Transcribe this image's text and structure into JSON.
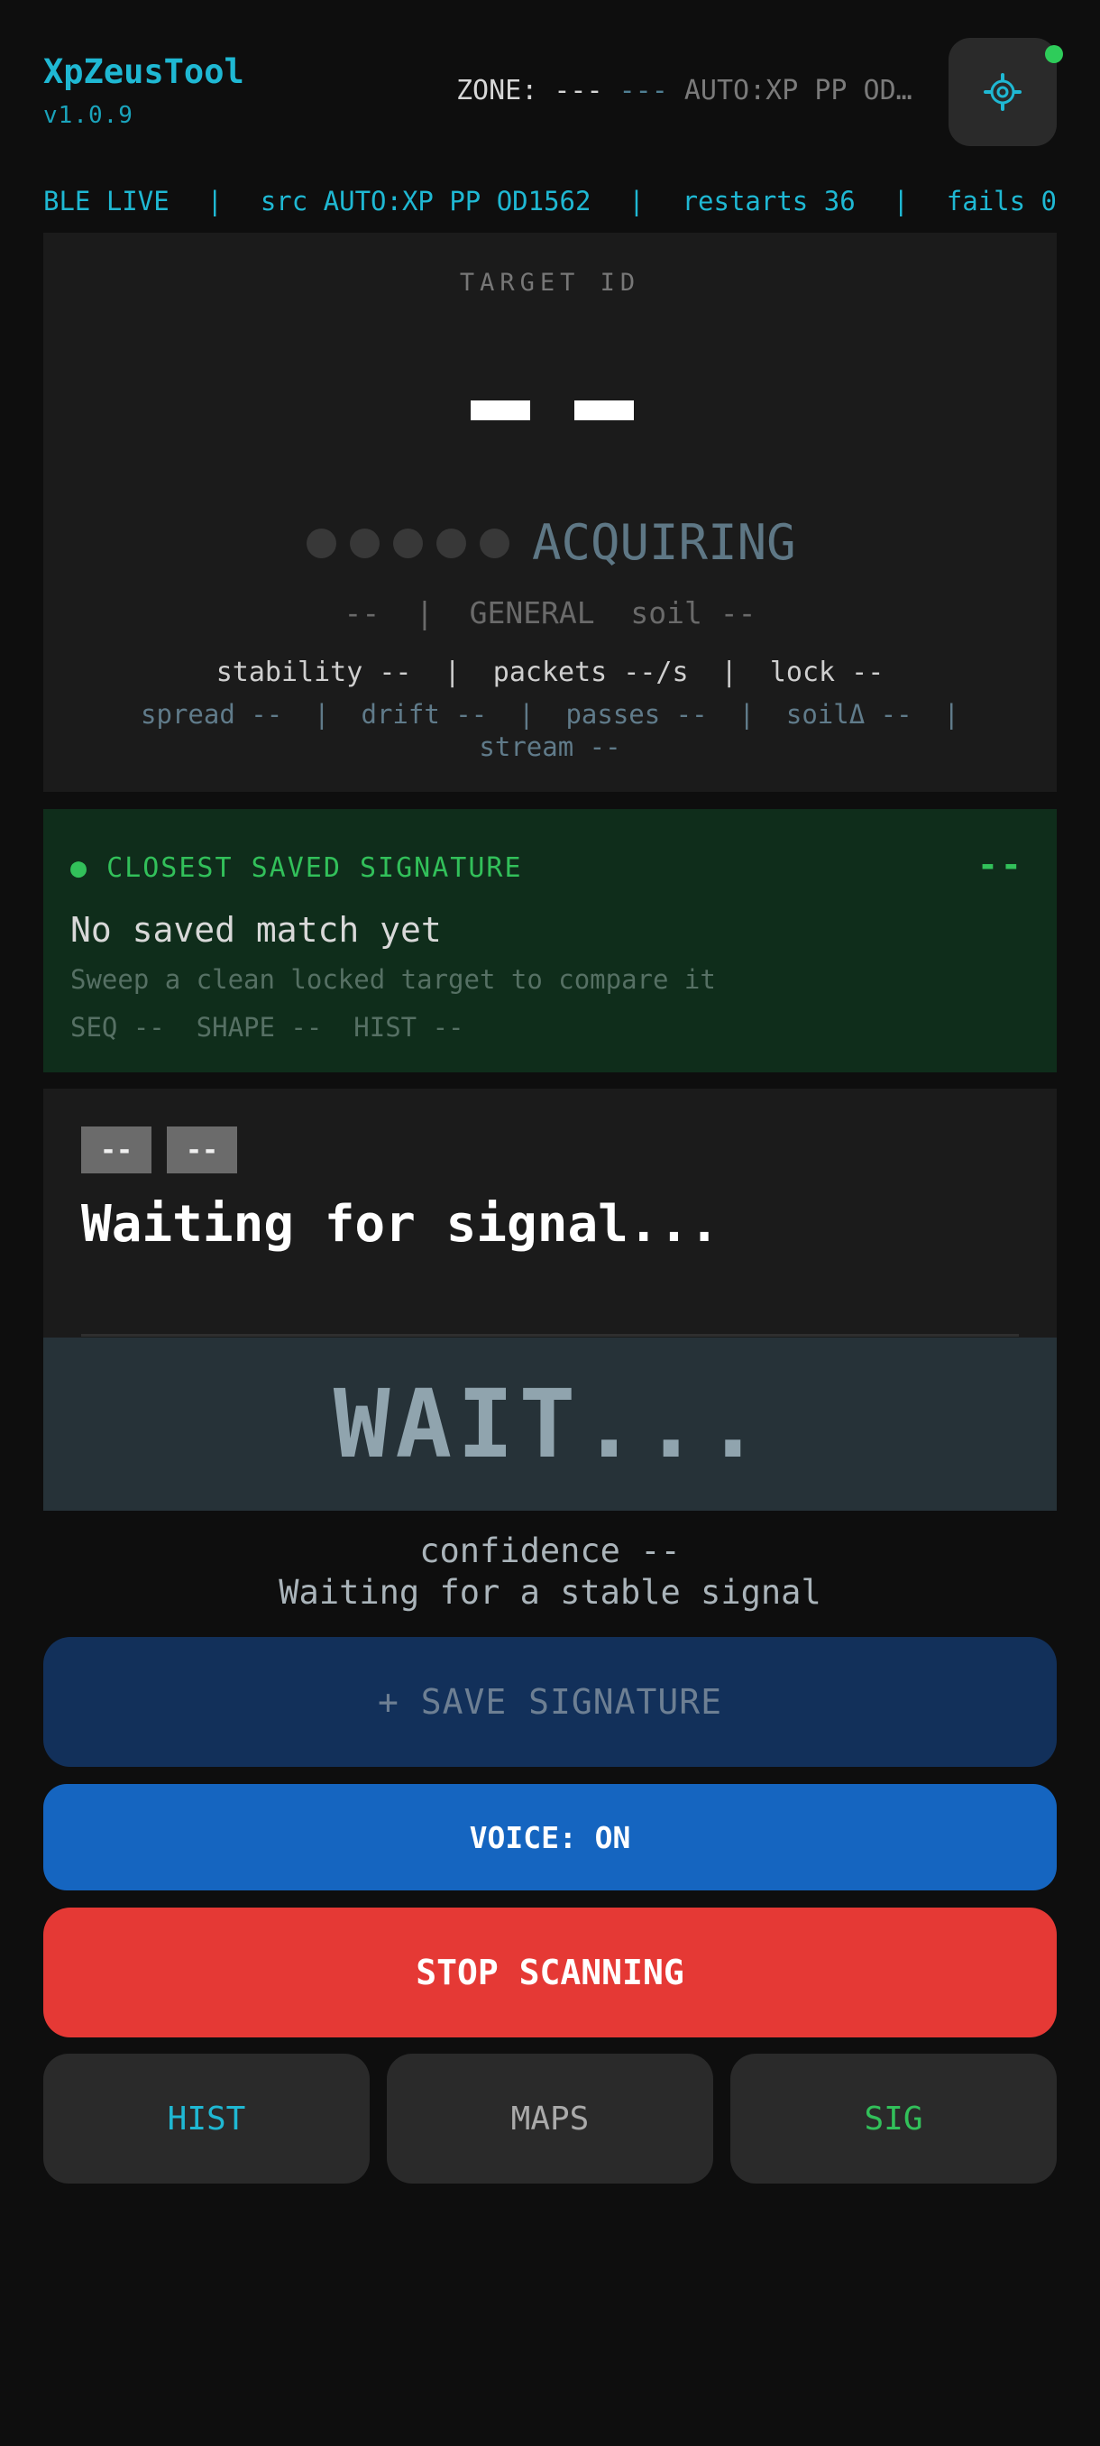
{
  "header": {
    "app_title": "XpZeusTool",
    "version": "v1.0.9",
    "zone_label": "ZONE:",
    "zone_value": "---",
    "zone_dashes": "---",
    "zone_source": "AUTO:XP PP OD…",
    "settings_icon": "gear-icon",
    "status_color": "#2ecc5a"
  },
  "ble_strip": {
    "ble": "BLE LIVE",
    "sep": "|",
    "src": "src AUTO:XP PP OD1562",
    "restarts": "restarts 36",
    "fails": "fails 0"
  },
  "target": {
    "label": "TARGET ID",
    "status": "ACQUIRING",
    "mode_line": "--  |  GENERAL  soil --",
    "stats_line": "stability --  |  packets --/s  |  lock --",
    "metrics_line": "spread --  |  drift --  |  passes --  |  soilΔ --  |\nstream --"
  },
  "signature": {
    "header": "● CLOSEST SAVED SIGNATURE",
    "score": "--",
    "title": "No saved match yet",
    "subtitle": "Sweep a clean locked target to compare it",
    "tags": "SEQ --  SHAPE --  HIST --"
  },
  "signal": {
    "chip_1": "--",
    "chip_2": "--",
    "title": "Waiting for signal...",
    "verdict": "WAIT...",
    "confidence": "confidence --",
    "confidence_sub": "Waiting for a stable signal"
  },
  "buttons": {
    "save": "+ SAVE SIGNATURE",
    "voice": "VOICE: ON",
    "stop": "STOP SCANNING",
    "hist": "HIST",
    "maps": "MAPS",
    "sig": "SIG"
  },
  "colors": {
    "accent": "#1fb8d3",
    "green": "#32c05a",
    "stop": "#e53935",
    "voice": "#1565c0"
  }
}
